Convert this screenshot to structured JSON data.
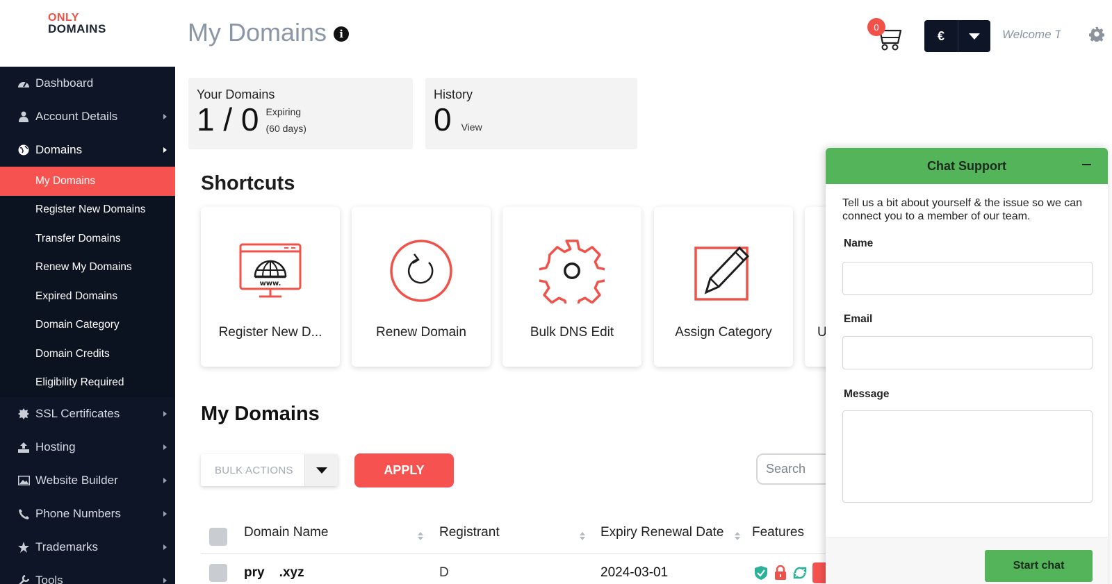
{
  "brand": {
    "line1": "ONLY",
    "line2": "DOMAINS",
    "accent": "#f0524a",
    "dark": "#0d1526"
  },
  "header": {
    "title": "My Domains",
    "cart_count": "0",
    "currency_symbol": "€",
    "welcome": "Welcome Tr"
  },
  "sidebar": {
    "items": [
      {
        "label": "Dashboard",
        "icon": "dashboard-icon"
      },
      {
        "label": "Account Details",
        "icon": "user-icon"
      },
      {
        "label": "Domains",
        "icon": "globe-icon"
      },
      {
        "label": "SSL Certificates",
        "icon": "certificate-icon"
      },
      {
        "label": "Hosting",
        "icon": "upload-icon"
      },
      {
        "label": "Website Builder",
        "icon": "image-icon"
      },
      {
        "label": "Phone Numbers",
        "icon": "phone-icon"
      },
      {
        "label": "Trademarks",
        "icon": "star-icon"
      },
      {
        "label": "Tools",
        "icon": "wrench-icon"
      }
    ],
    "domains_sub": [
      {
        "label": "My Domains"
      },
      {
        "label": "Register New Domains"
      },
      {
        "label": "Transfer Domains"
      },
      {
        "label": "Renew My Domains"
      },
      {
        "label": "Expired Domains"
      },
      {
        "label": "Domain Category"
      },
      {
        "label": "Domain Credits"
      },
      {
        "label": "Eligibility Required"
      }
    ]
  },
  "stats": {
    "your_domains": {
      "label": "Your Domains",
      "value": "1 / 0",
      "note1": "Expiring",
      "note2": "(60 days)"
    },
    "history": {
      "label": "History",
      "value": "0",
      "link": "View"
    }
  },
  "shortcuts": {
    "title": "Shortcuts",
    "items": [
      {
        "label": "Register New D...",
        "icon": "www-monitor-icon"
      },
      {
        "label": "Renew Domain",
        "icon": "renew-icon"
      },
      {
        "label": "Bulk DNS Edit",
        "icon": "gear-icon"
      },
      {
        "label": "Assign Category",
        "icon": "edit-icon"
      },
      {
        "label": "U",
        "icon": "partial-icon"
      }
    ]
  },
  "domains_section": {
    "title": "My Domains",
    "bulk_placeholder": "BULK ACTIONS",
    "apply_label": "APPLY",
    "search_placeholder": "Search",
    "columns": [
      "Domain Name",
      "Registrant",
      "Expiry Renewal Date",
      "Features"
    ],
    "rows": [
      {
        "domain": "pry    .xyz",
        "registrant": "D",
        "expiry": "2024-03-01"
      }
    ]
  },
  "chat": {
    "title": "Chat Support",
    "intro": "Tell us a bit about yourself & the issue so we can connect you to a member of our team.",
    "name_label": "Name",
    "email_label": "Email",
    "message_label": "Message",
    "button_label": "Start chat",
    "color": "#54b45a"
  }
}
